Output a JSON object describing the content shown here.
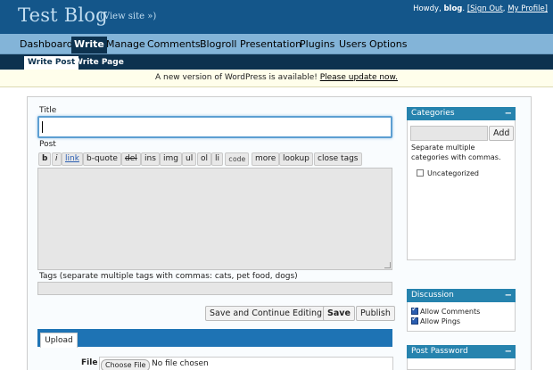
{
  "header": {
    "blog_title": "Test Blog",
    "view_site": "(View site »)",
    "howdy": "Howdy, ",
    "username": "blog",
    "sign_out": "[Sign Out",
    "my_profile": "My Profile]"
  },
  "nav": {
    "items": [
      "Dashboard",
      "Write",
      "Manage",
      "Comments",
      "Blogroll",
      "Presentation",
      "Plugins",
      "Users",
      "Options"
    ],
    "active": "Write"
  },
  "subnav": {
    "items": [
      "Write Post",
      "Write Page"
    ],
    "active": "Write Post"
  },
  "notice": {
    "text": "A new version of WordPress is available! ",
    "link": "Please update now."
  },
  "post": {
    "title_label": "Title",
    "title_value": "",
    "post_label": "Post",
    "quicktags": [
      "b",
      "i",
      "link",
      "b-quote",
      "del",
      "ins",
      "img",
      "ul",
      "ol",
      "li",
      "code",
      "more",
      "lookup",
      "close tags"
    ],
    "tags_label": "Tags (separate multiple tags with commas: cats, pet food, dogs)",
    "buttons": {
      "save_continue": "Save and Continue Editing",
      "save": "Save",
      "publish": "Publish"
    }
  },
  "upload": {
    "tab": "Upload",
    "file_label": "File",
    "choose_button": "Choose File",
    "no_file": "No file chosen"
  },
  "sidebar": {
    "categories": {
      "title": "Categories",
      "toggle": "−",
      "add_button": "Add",
      "help": "Separate multiple categories with commas.",
      "items": [
        {
          "label": "Uncategorized",
          "checked": false
        }
      ]
    },
    "discussion": {
      "title": "Discussion",
      "toggle": "−",
      "items": [
        {
          "label": "Allow Comments",
          "checked": true
        },
        {
          "label": "Allow Pings",
          "checked": true
        }
      ]
    },
    "password": {
      "title": "Post Password",
      "toggle": "−"
    }
  },
  "colors": {
    "header_bg": "#14568a",
    "nav_bg": "#83b4d8",
    "submenu_bg": "#0d324f",
    "box_header": "#2683ae",
    "notice_bg": "#fffeeb"
  }
}
